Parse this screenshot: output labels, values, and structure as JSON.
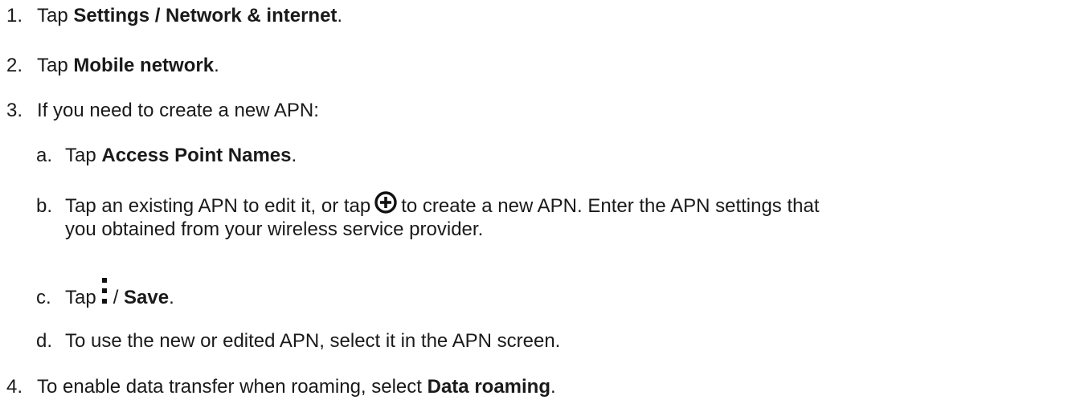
{
  "steps": [
    {
      "num": "1.",
      "pre": "Tap ",
      "bold": "Settings / Network & internet",
      "post": "."
    },
    {
      "num": "2.",
      "pre": "Tap ",
      "bold": "Mobile network",
      "post": "."
    },
    {
      "num": "3.",
      "text": "If you need to create a new APN:"
    },
    {
      "num": "4.",
      "pre": "To enable data transfer when roaming, select ",
      "bold": "Data roaming",
      "post": "."
    }
  ],
  "substeps": {
    "a": {
      "letter": "a.",
      "pre": "Tap ",
      "bold": "Access Point Names",
      "post": "."
    },
    "b": {
      "letter": "b.",
      "pre": "Tap an existing APN to edit it, or tap",
      "icon": "plus-circle-icon",
      "post": "to create a new APN. Enter the APN settings that",
      "line2": "you obtained from your wireless service provider."
    },
    "c": {
      "letter": "c.",
      "pre": "Tap",
      "icon": "more-vertical-icon",
      "post": "/ ",
      "bold": "Save",
      "end": "."
    },
    "d": {
      "letter": "d.",
      "text": "To use the new or edited APN, select it in the APN screen."
    }
  }
}
